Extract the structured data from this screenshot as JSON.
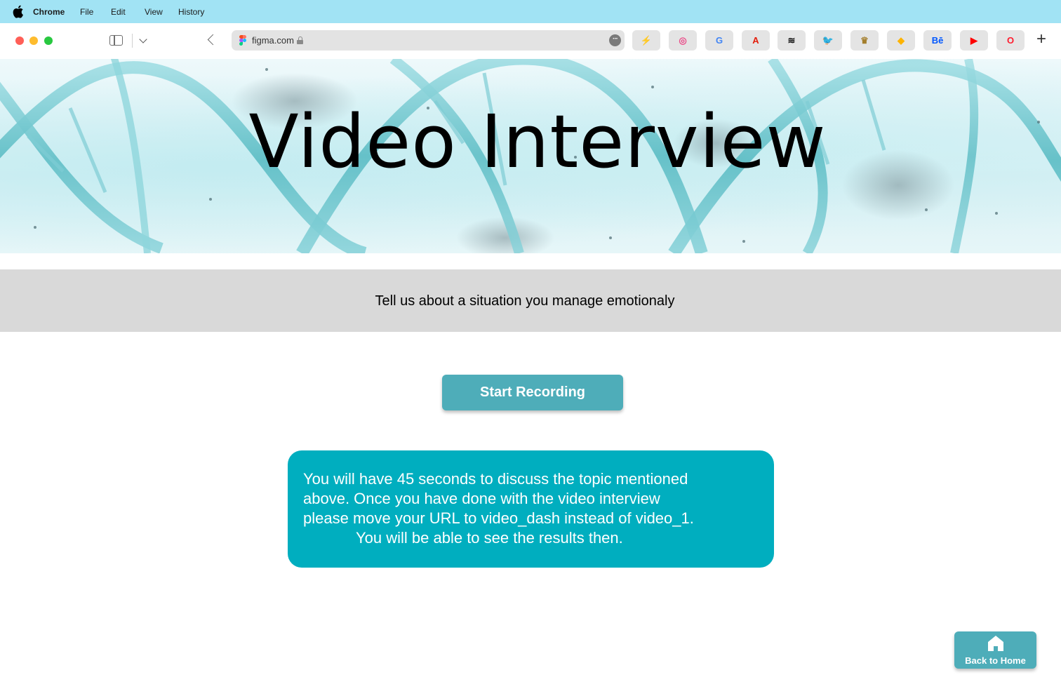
{
  "menubar": {
    "app_name": "Chrome",
    "items": [
      "File",
      "Edit",
      "View",
      "History"
    ]
  },
  "browser": {
    "url": "figma.com",
    "bookmarks": [
      {
        "name": "spark",
        "glyph": "⚡",
        "color": "#f5b700"
      },
      {
        "name": "dribbble",
        "glyph": "◎",
        "color": "#ea4c89"
      },
      {
        "name": "google",
        "glyph": "G",
        "color": "#4285f4"
      },
      {
        "name": "adobe",
        "glyph": "A",
        "color": "#e31d0b"
      },
      {
        "name": "adidas",
        "glyph": "≋",
        "color": "#111111"
      },
      {
        "name": "twitter",
        "glyph": "🐦",
        "color": "#1da1f2"
      },
      {
        "name": "rolex",
        "glyph": "♛",
        "color": "#a37e2c"
      },
      {
        "name": "sketch",
        "glyph": "◆",
        "color": "#fdb300"
      },
      {
        "name": "behance",
        "glyph": "Bē",
        "color": "#0057ff"
      },
      {
        "name": "youtube",
        "glyph": "▶",
        "color": "#ff0000"
      },
      {
        "name": "opera",
        "glyph": "O",
        "color": "#ff1b2d"
      }
    ]
  },
  "hero": {
    "title": "Video Interview"
  },
  "question": {
    "text": "Tell us about a situation you manage emotionaly"
  },
  "actions": {
    "start_recording": "Start Recording",
    "back_to_home": "Back to Home"
  },
  "info": {
    "lines": [
      "You will have 45 seconds to discuss the topic mentioned",
      "above. Once  you  have  done  with  the  video  interview",
      "please move your URL to  video_dash instead of video_1.",
      "You will  be able to see the results then."
    ]
  },
  "colors": {
    "menubar": "#a1e3f4",
    "button_teal": "#4eadb9",
    "info_box": "#00aebf",
    "question_band": "#d9d9d9"
  }
}
